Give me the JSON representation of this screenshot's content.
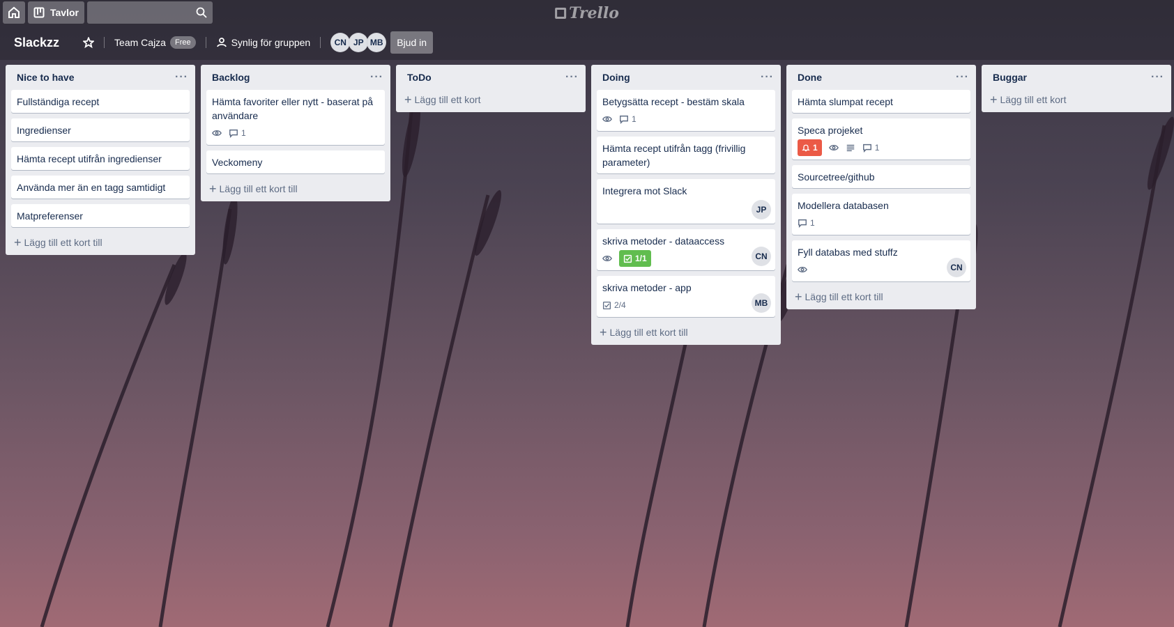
{
  "topbar": {
    "boards_label": "Tavlor",
    "logo_text": "Trello"
  },
  "board": {
    "title": "Slackzz",
    "team_name": "Team Cajza",
    "team_badge": "Free",
    "visibility": "Synlig för gruppen",
    "members": [
      "CN",
      "JP",
      "MB"
    ],
    "invite_label": "Bjud in"
  },
  "lists": [
    {
      "title": "Nice to have",
      "menu": "···",
      "cards": [
        {
          "title": "Fullständiga recept"
        },
        {
          "title": "Ingredienser"
        },
        {
          "title": "Hämta recept utifrån ingredienser"
        },
        {
          "title": "Använda mer än en tagg samtidigt"
        },
        {
          "title": "Matpreferenser"
        }
      ],
      "add_label": "Lägg till ett kort till"
    },
    {
      "title": "Backlog",
      "menu": "···",
      "cards": [
        {
          "title": "Hämta favoriter eller nytt - baserat på användare",
          "comments": "1"
        },
        {
          "title": "Veckomeny"
        }
      ],
      "add_label": "Lägg till ett kort till"
    },
    {
      "title": "ToDo",
      "menu": "···",
      "cards": [],
      "add_label": "Lägg till ett kort"
    },
    {
      "title": "Doing",
      "menu": "···",
      "cards": [
        {
          "title": "Betygsätta recept - bestäm skala",
          "comments": "1"
        },
        {
          "title": "Hämta recept utifrån tagg (frivillig parameter)"
        },
        {
          "title": "Integrera mot Slack",
          "member": "JP"
        },
        {
          "title": "skriva metoder - dataaccess",
          "checklist": "1/1",
          "member": "CN"
        },
        {
          "title": "skriva metoder - app",
          "checklist": "2/4",
          "member": "MB"
        }
      ],
      "add_label": "Lägg till ett kort till"
    },
    {
      "title": "Done",
      "menu": "···",
      "cards": [
        {
          "title": "Hämta slumpat recept"
        },
        {
          "title": "Speca projeket",
          "due": "1",
          "comments": "1"
        },
        {
          "title": "Sourcetree/github"
        },
        {
          "title": "Modellera databasen",
          "comments": "1"
        },
        {
          "title": "Fyll databas med stuffz",
          "member": "CN"
        }
      ],
      "add_label": "Lägg till ett kort till"
    },
    {
      "title": "Buggar",
      "menu": "···",
      "cards": [],
      "add_label": "Lägg till ett kort"
    }
  ],
  "colors": {
    "list_bg": "#ebecf0",
    "due_red": "#eb5a46",
    "check_green": "#61bd4f"
  }
}
